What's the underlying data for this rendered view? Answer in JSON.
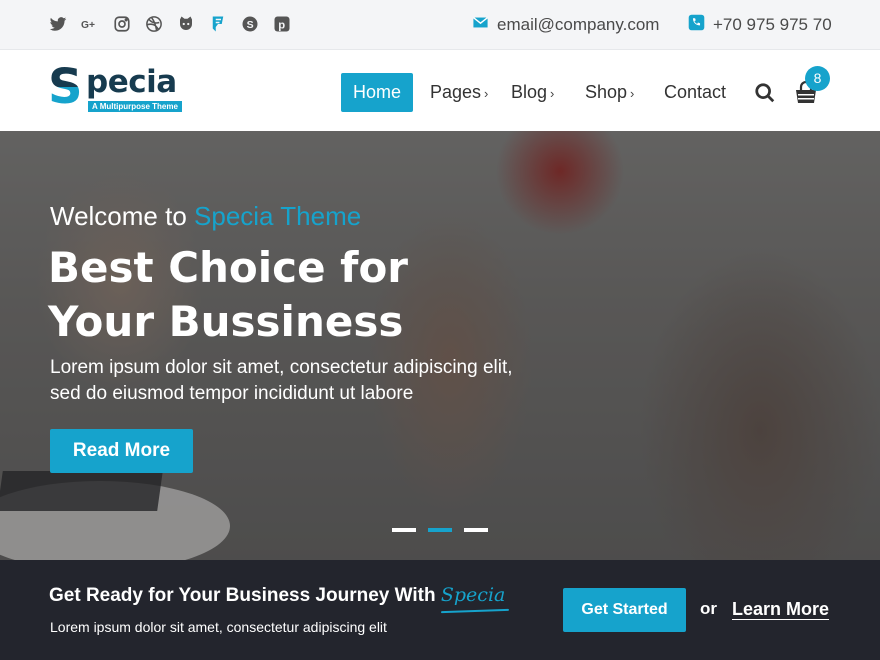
{
  "topbar": {
    "social": [
      "twitter-icon",
      "google-plus-icon",
      "instagram-icon",
      "dribbble-icon",
      "github-icon",
      "foursquare-icon",
      "skype-icon",
      "pinterest-icon"
    ],
    "email": "email@company.com",
    "phone": "+70 975 975 70"
  },
  "logo": {
    "initial": "S",
    "name": "pecia",
    "tagline": "A Multipurpose Theme"
  },
  "nav": {
    "items": [
      {
        "label": "Home",
        "active": true
      },
      {
        "label": "Pages",
        "has_submenu": true
      },
      {
        "label": "Blog",
        "has_submenu": true
      },
      {
        "label": "Shop",
        "has_submenu": true
      },
      {
        "label": "Contact"
      }
    ],
    "cart_count": "8"
  },
  "hero": {
    "welcome_prefix": "Welcome to ",
    "welcome_accent": "Specia Theme",
    "title": "Best Choice for Your Bussiness",
    "text": "Lorem ipsum dolor sit amet, consectetur adipiscing elit, sed do eiusmod tempor incididunt ut labore",
    "button": "Read More",
    "slides": 3,
    "active_slide": 2
  },
  "cta": {
    "heading": "Get Ready for Your Business Journey With ",
    "brand": "Specia",
    "subtext": "Lorem ipsum dolor sit amet, consectetur adipiscing elit",
    "primary_button": "Get Started",
    "or": "or",
    "secondary_link": "Learn More"
  },
  "colors": {
    "accent": "#16a3cc",
    "topbar_bg": "#f4f5f7",
    "cta_bg": "#23252d",
    "logo_dark": "#173b4f"
  }
}
